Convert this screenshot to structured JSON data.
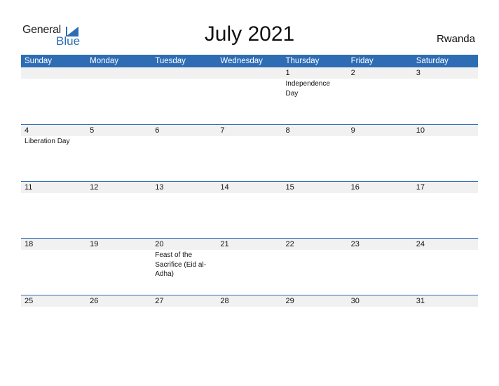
{
  "logo": {
    "general": "General",
    "blue": "Blue"
  },
  "title": "July 2021",
  "country": "Rwanda",
  "accent_color": "#2e6db4",
  "weekdays": [
    "Sunday",
    "Monday",
    "Tuesday",
    "Wednesday",
    "Thursday",
    "Friday",
    "Saturday"
  ],
  "weeks": [
    {
      "days": [
        "",
        "",
        "",
        "",
        "1",
        "2",
        "3"
      ],
      "events": [
        "",
        "",
        "",
        "",
        "Independence Day",
        "",
        ""
      ]
    },
    {
      "days": [
        "4",
        "5",
        "6",
        "7",
        "8",
        "9",
        "10"
      ],
      "events": [
        "Liberation Day",
        "",
        "",
        "",
        "",
        "",
        ""
      ]
    },
    {
      "days": [
        "11",
        "12",
        "13",
        "14",
        "15",
        "16",
        "17"
      ],
      "events": [
        "",
        "",
        "",
        "",
        "",
        "",
        ""
      ]
    },
    {
      "days": [
        "18",
        "19",
        "20",
        "21",
        "22",
        "23",
        "24"
      ],
      "events": [
        "",
        "",
        "Feast of the Sacrifice (Eid al-Adha)",
        "",
        "",
        "",
        ""
      ]
    },
    {
      "days": [
        "25",
        "26",
        "27",
        "28",
        "29",
        "30",
        "31"
      ],
      "events": [
        "",
        "",
        "",
        "",
        "",
        "",
        ""
      ]
    }
  ]
}
